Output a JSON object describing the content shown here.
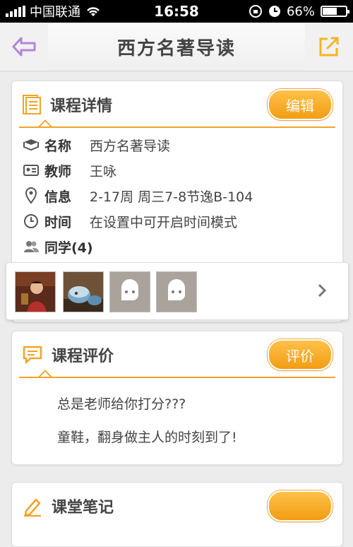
{
  "status_bar": {
    "carrier": "中国联通",
    "time": "16:58",
    "battery": "66%",
    "battery_level": 0.66
  },
  "nav": {
    "title": "西方名著导读",
    "back_icon": "back-arrow-icon",
    "share_icon": "share-icon"
  },
  "details": {
    "title": "课程详情",
    "edit_label": "编辑",
    "rows": [
      {
        "icon": "book-icon",
        "label": "名称",
        "value": "西方名著导读"
      },
      {
        "icon": "id-card-icon",
        "label": "教师",
        "value": "王咏"
      },
      {
        "icon": "location-pin-icon",
        "label": "信息",
        "value": "2-17周 周三7-8节逸B-104"
      },
      {
        "icon": "clock-icon",
        "label": "时间",
        "value": "在设置中可开启时间模式"
      }
    ],
    "classmates_label": "同学(4)"
  },
  "review": {
    "title": "课程评价",
    "button_label": "评价",
    "lines": [
      "总是老师给你打分???",
      "童鞋，翻身做主人的时刻到了!"
    ]
  },
  "notes": {
    "title": "课堂笔记"
  },
  "colors": {
    "accent": "#f2a427",
    "back_icon": "#b286d6",
    "share_icon": "#f5b522"
  }
}
